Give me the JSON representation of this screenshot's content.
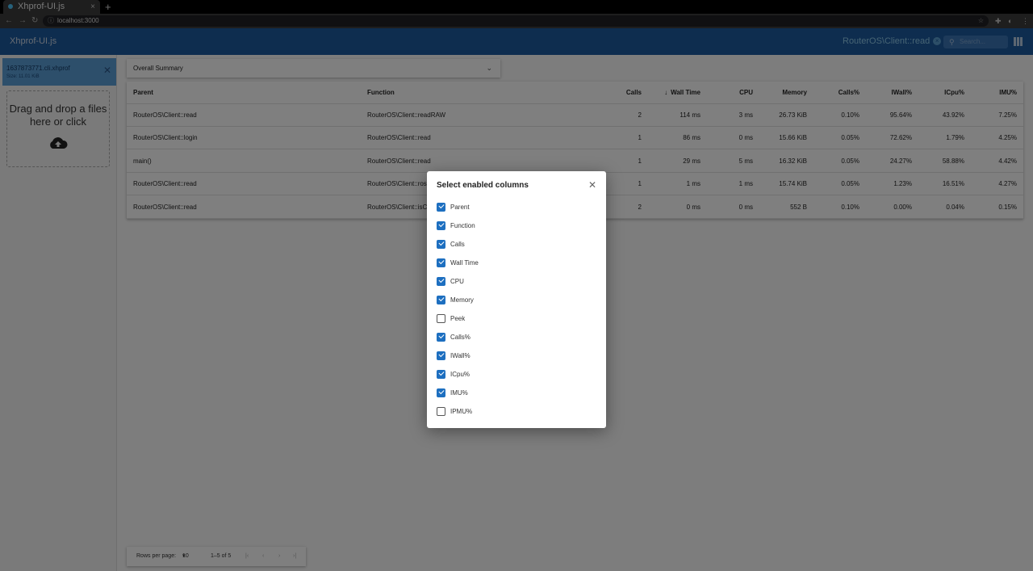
{
  "browser": {
    "tab_title": "Xhprof-UI.js",
    "tab_close": "×",
    "new_tab": "+",
    "url": "localhost:3000"
  },
  "appbar": {
    "title": "Xhprof-UI.js",
    "active_filter": "RouterOS\\Client::read",
    "search_placeholder": "Search..."
  },
  "sidebar": {
    "file_name": "1637873771.cli.xhprof",
    "file_size": "Size: 11.01 KiB",
    "dropzone_text": "Drag and drop a files here or click"
  },
  "summary_select": {
    "value": "Overall Summary"
  },
  "table": {
    "headers": [
      "Parent",
      "Function",
      "Calls",
      "Wall Time",
      "CPU",
      "Memory",
      "Calls%",
      "IWall%",
      "ICpu%",
      "IMU%"
    ],
    "sort_column": "Wall Time",
    "rows": [
      [
        "RouterOS\\Client::read",
        "RouterOS\\Client::readRAW",
        "2",
        "114 ms",
        "3 ms",
        "26.73 KiB",
        "0.10%",
        "95.64%",
        "43.92%",
        "7.25%"
      ],
      [
        "RouterOS\\Client::login",
        "RouterOS\\Client::read",
        "1",
        "86 ms",
        "0 ms",
        "15.66 KiB",
        "0.05%",
        "72.62%",
        "1.79%",
        "4.25%"
      ],
      [
        "main()",
        "RouterOS\\Client::read",
        "1",
        "29 ms",
        "5 ms",
        "16.32 KiB",
        "0.05%",
        "24.27%",
        "58.88%",
        "4.42%"
      ],
      [
        "RouterOS\\Client::read",
        "RouterOS\\Client::ros",
        "1",
        "1 ms",
        "1 ms",
        "15.74 KiB",
        "0.05%",
        "1.23%",
        "16.51%",
        "4.27%"
      ],
      [
        "RouterOS\\Client::read",
        "RouterOS\\Client::isC",
        "2",
        "0 ms",
        "0 ms",
        "552 B",
        "0.10%",
        "0.00%",
        "0.04%",
        "0.15%"
      ]
    ]
  },
  "dialog": {
    "title": "Select enabled columns",
    "options": [
      {
        "label": "Parent",
        "checked": true
      },
      {
        "label": "Function",
        "checked": true
      },
      {
        "label": "Calls",
        "checked": true
      },
      {
        "label": "Wall Time",
        "checked": true
      },
      {
        "label": "CPU",
        "checked": true
      },
      {
        "label": "Memory",
        "checked": true
      },
      {
        "label": "Peek",
        "checked": false
      },
      {
        "label": "Calls%",
        "checked": true
      },
      {
        "label": "IWall%",
        "checked": true
      },
      {
        "label": "ICpu%",
        "checked": true
      },
      {
        "label": "IMU%",
        "checked": true
      },
      {
        "label": "IPMU%",
        "checked": false
      }
    ]
  },
  "pagination": {
    "rows_label": "Rows per page:",
    "rows_value": "10",
    "range": "1–5 of 5"
  },
  "colors": {
    "appbar": "#1d5a9e",
    "accent": "#1d6fc0",
    "file_card": "#5a9ed6"
  }
}
